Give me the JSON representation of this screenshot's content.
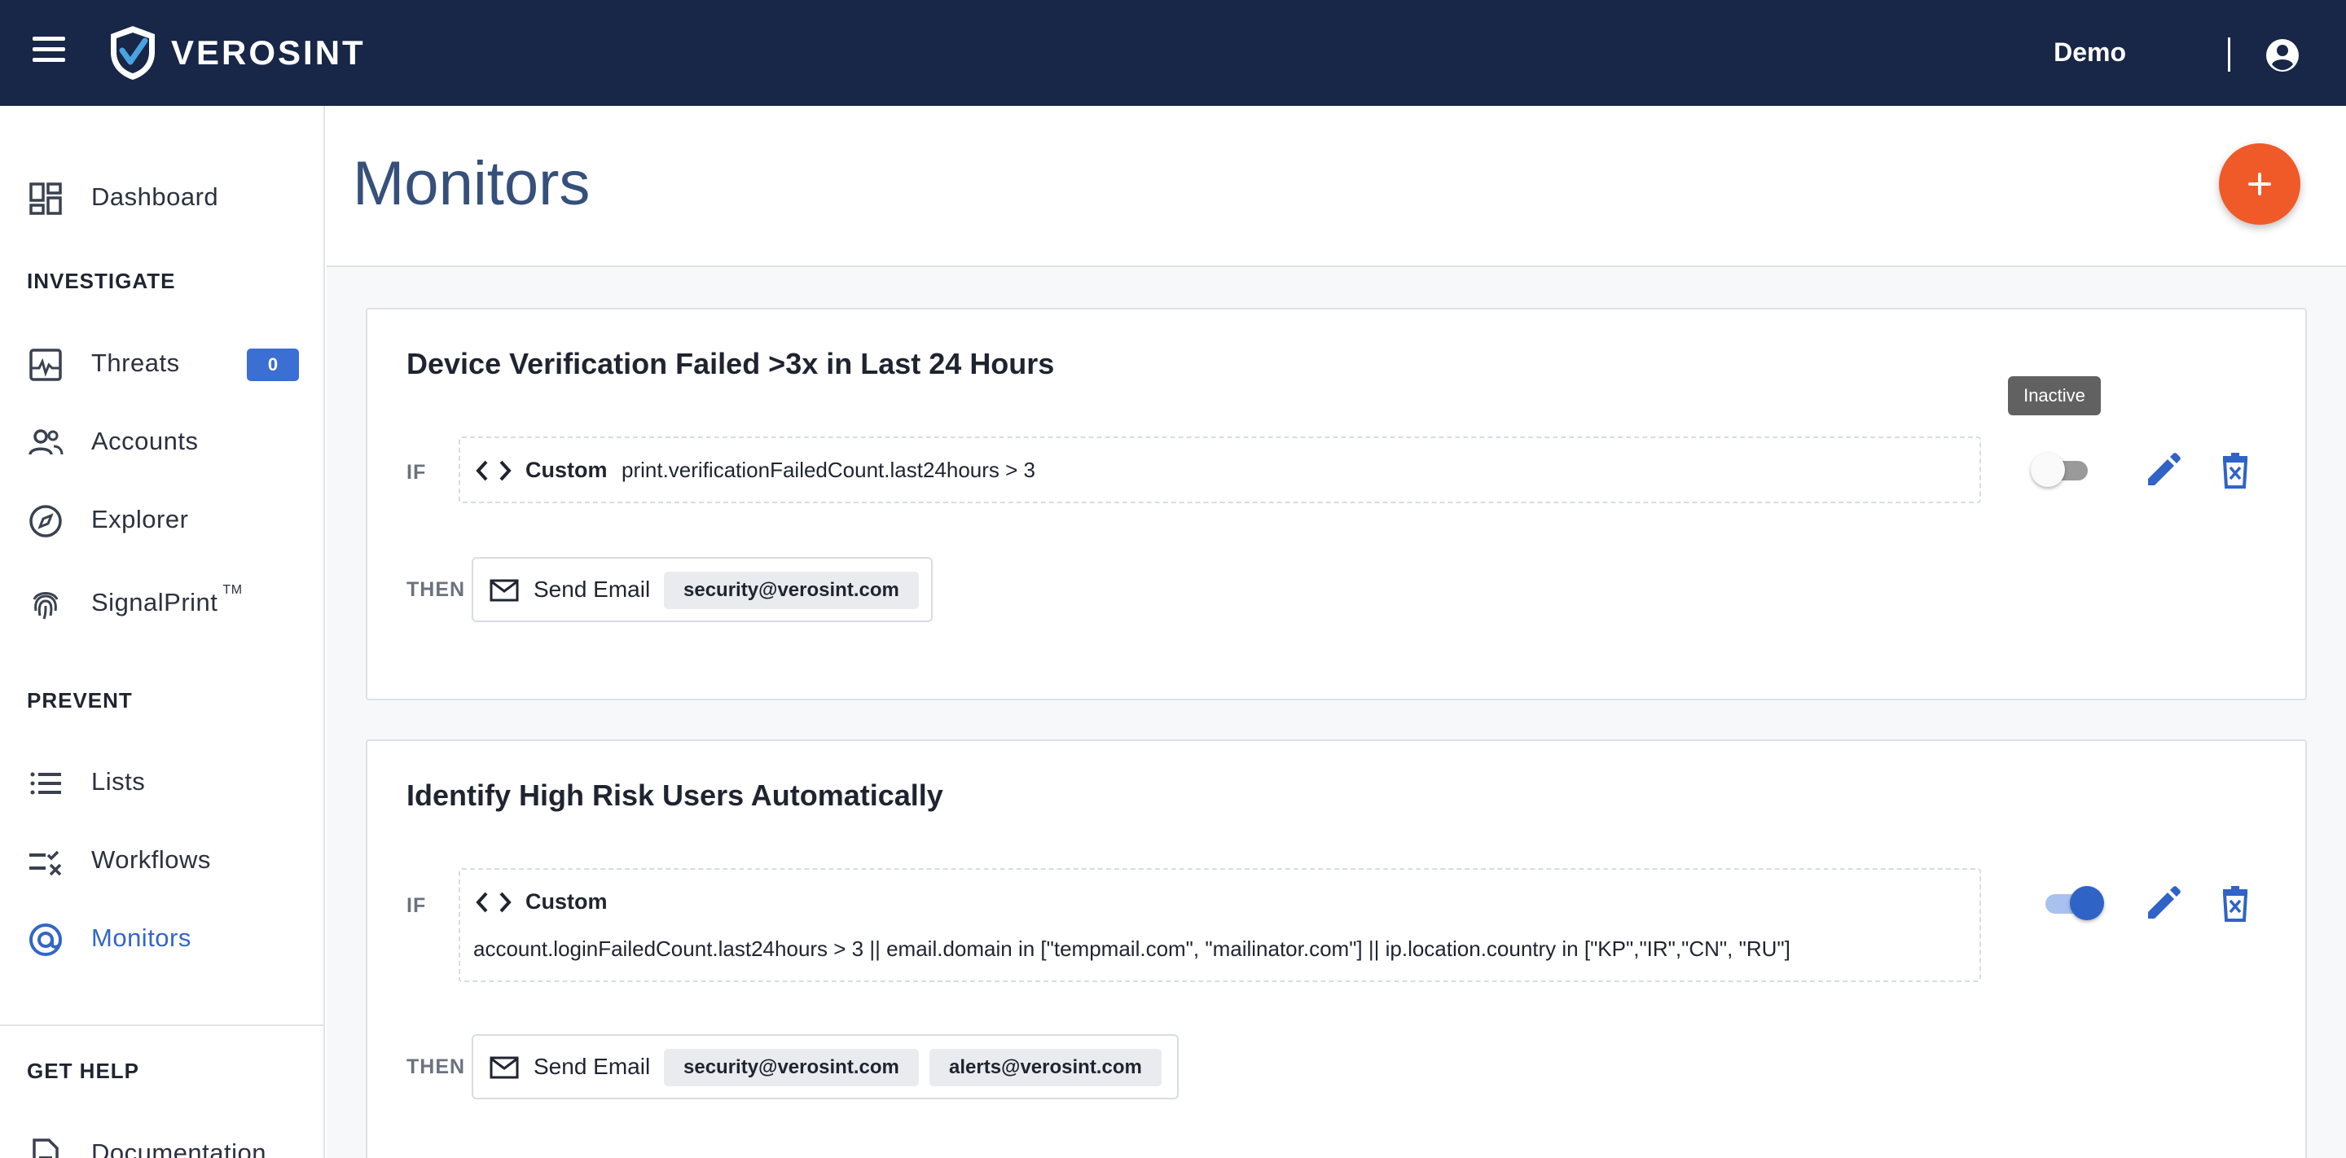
{
  "header": {
    "brand": "VEROSINT",
    "user_name": "Demo",
    "menu_icon": "menu-icon",
    "user_icon": "account-circle-icon"
  },
  "sidebar": {
    "dashboard": "Dashboard",
    "section_investigate": "INVESTIGATE",
    "threats": "Threats",
    "threats_count": "0",
    "accounts": "Accounts",
    "explorer": "Explorer",
    "signalprint": "SignalPrint",
    "signalprint_tm": "TM",
    "section_prevent": "PREVENT",
    "lists": "Lists",
    "workflows": "Workflows",
    "monitors": "Monitors",
    "section_help": "GET HELP",
    "documentation": "Documentation"
  },
  "page": {
    "title": "Monitors",
    "add_button_icon": "plus-icon"
  },
  "monitors": [
    {
      "title": "Device Verification Failed >3x in Last 24 Hours",
      "if_label": "IF",
      "condition_type": "Custom",
      "expression": "print.verificationFailedCount.last24hours > 3",
      "then_label": "THEN",
      "action": "Send Email",
      "recipients": [
        "security@verosint.com"
      ],
      "active": false,
      "tooltip": "Inactive"
    },
    {
      "title": "Identify High Risk Users Automatically",
      "if_label": "IF",
      "condition_type": "Custom",
      "expression": "account.loginFailedCount.last24hours > 3 || email.domain in [\"tempmail.com\", \"mailinator.com\"] || ip.location.country in [\"KP\",\"IR\",\"CN\", \"RU\"]",
      "then_label": "THEN",
      "action": "Send Email",
      "recipients": [
        "security@verosint.com",
        "alerts@verosint.com"
      ],
      "active": true
    }
  ],
  "colors": {
    "header_bg": "#182647",
    "accent": "#3366c7",
    "fab": "#f05a28"
  }
}
